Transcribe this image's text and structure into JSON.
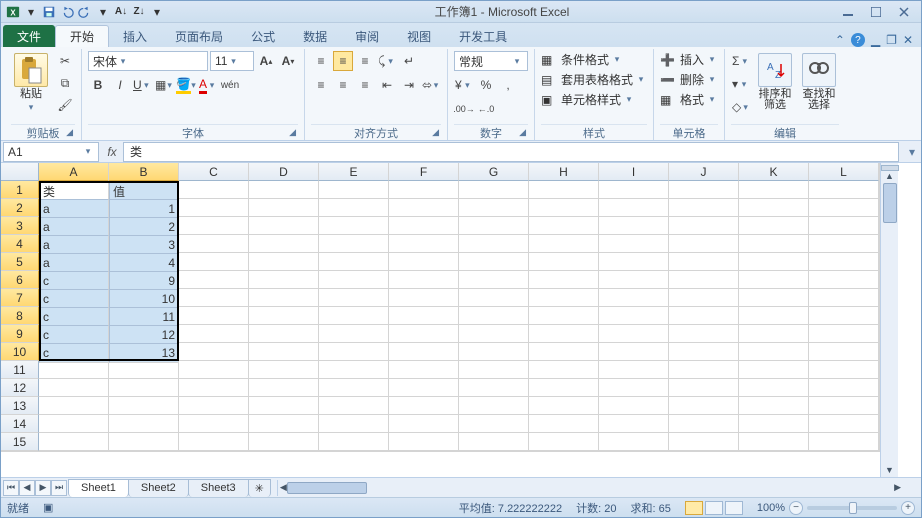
{
  "title": "工作簿1 - Microsoft Excel",
  "tabs": {
    "file": "文件",
    "home": "开始",
    "insert": "插入",
    "layout": "页面布局",
    "formulas": "公式",
    "data": "数据",
    "review": "审阅",
    "view": "视图",
    "dev": "开发工具"
  },
  "ribbon": {
    "clipboard": {
      "paste": "粘贴",
      "label": "剪贴板"
    },
    "font": {
      "name": "宋体",
      "size": "11",
      "label": "字体"
    },
    "align": {
      "label": "对齐方式"
    },
    "number": {
      "format": "常规",
      "label": "数字"
    },
    "styles": {
      "cond": "条件格式",
      "table": "套用表格格式",
      "cell": "单元格样式",
      "label": "样式"
    },
    "cells": {
      "insert": "插入",
      "delete": "删除",
      "format": "格式",
      "label": "单元格"
    },
    "editing": {
      "sort": "排序和筛选",
      "find": "查找和选择",
      "label": "编辑"
    }
  },
  "namebox": "A1",
  "formula": "类",
  "columns": [
    "A",
    "B",
    "C",
    "D",
    "E",
    "F",
    "G",
    "H",
    "I",
    "J",
    "K",
    "L"
  ],
  "rows": [
    "1",
    "2",
    "3",
    "4",
    "5",
    "6",
    "7",
    "8",
    "9",
    "10",
    "11",
    "12",
    "13",
    "14",
    "15"
  ],
  "cells": {
    "A1": "类",
    "B1": "值",
    "A2": "a",
    "B2": "1",
    "A3": "a",
    "B3": "2",
    "A4": "a",
    "B4": "3",
    "A5": "a",
    "B5": "4",
    "A6": "c",
    "B6": "9",
    "A7": "c",
    "B7": "10",
    "A8": "c",
    "B8": "11",
    "A9": "c",
    "B9": "12",
    "A10": "c",
    "B10": "13"
  },
  "sheets": {
    "s1": "Sheet1",
    "s2": "Sheet2",
    "s3": "Sheet3"
  },
  "status": {
    "ready": "就绪",
    "avg": "平均值: 7.222222222",
    "count": "计数: 20",
    "sum": "求和: 65",
    "zoom": "100%"
  }
}
